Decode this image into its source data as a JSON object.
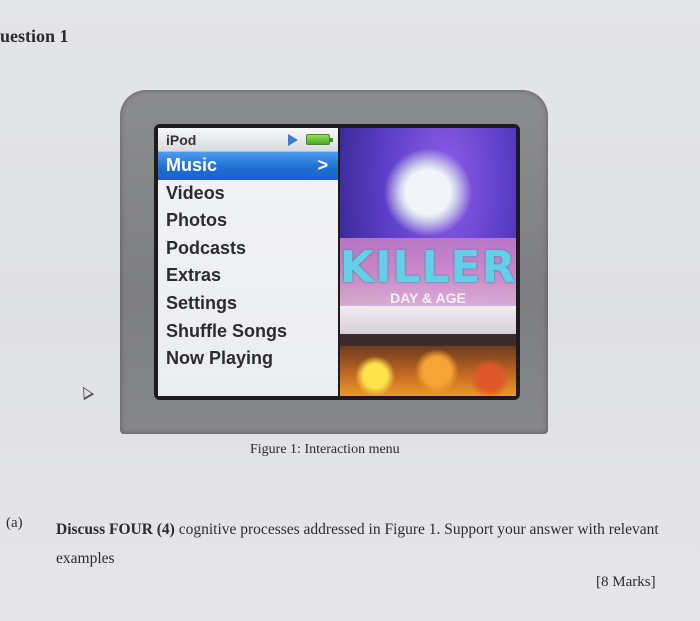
{
  "heading": "uestion 1",
  "ipod": {
    "title": "iPod",
    "menu_items": [
      "Music",
      "Videos",
      "Photos",
      "Podcasts",
      "Extras",
      "Settings",
      "Shuffle Songs",
      "Now Playing"
    ],
    "selected_index": 0,
    "selected_chevron": ">",
    "album_title": "KILLERS",
    "album_subtitle": "DAY & AGE",
    "colors": {
      "selection": "#2a7be0",
      "frame": "#858689"
    },
    "icons": [
      "play-icon",
      "battery-icon"
    ]
  },
  "figure_caption": "Figure 1: Interaction menu",
  "question": {
    "label": "(a)",
    "text_bold_part": "Discuss FOUR (4)",
    "text_rest": " cognitive processes addressed in Figure 1. Support your answer with relevant examples",
    "marks": "[8 Marks]"
  }
}
